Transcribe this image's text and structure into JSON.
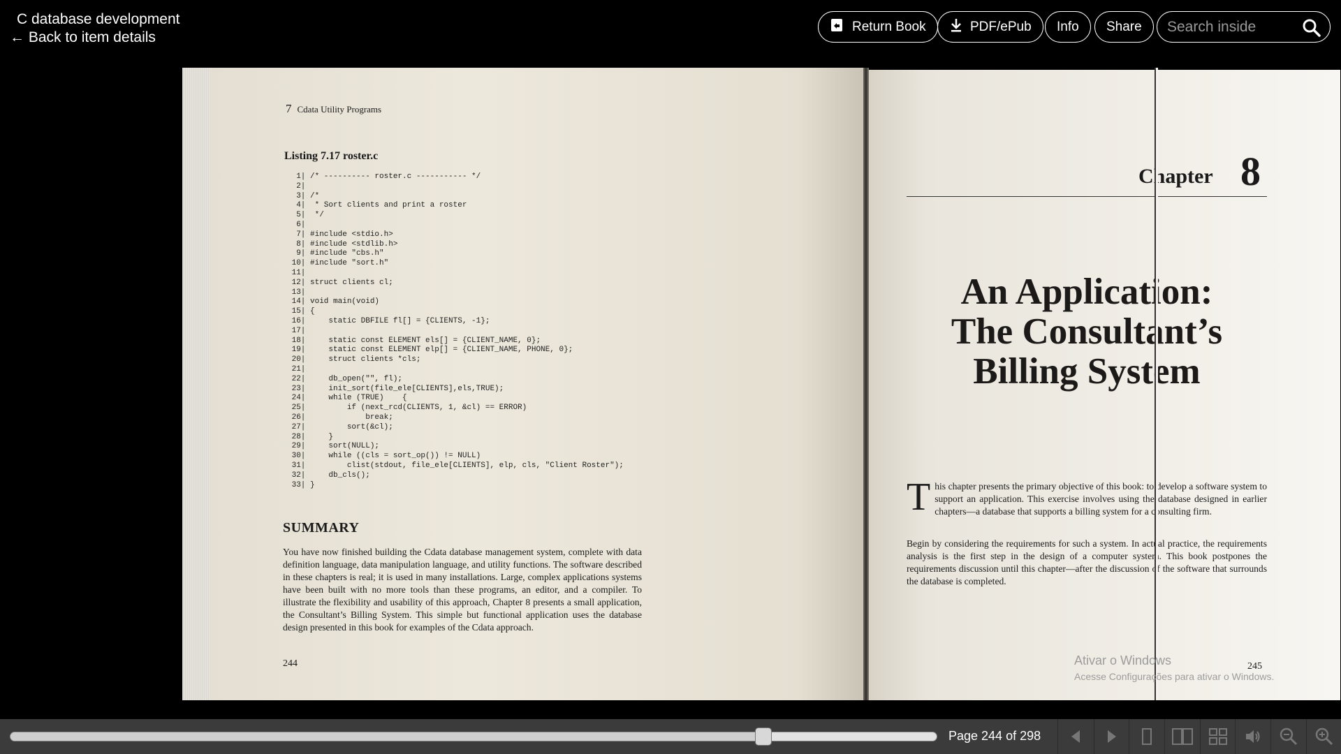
{
  "header": {
    "book_title": "C database development",
    "back_label": "← Back to item details",
    "buttons": {
      "return_book": "Return Book",
      "pdf_epub": "PDF/ePub",
      "info": "Info",
      "share": "Share"
    },
    "search_placeholder": "Search inside"
  },
  "left_page": {
    "chapter_num": "7",
    "running_head": "Cdata Utility Programs",
    "listing_title": "Listing 7.17 roster.c",
    "code": "  1| /* ---------- roster.c ----------- */\n  2|\n  3| /*\n  4|  * Sort clients and print a roster\n  5|  */\n  6|\n  7| #include <stdio.h>\n  8| #include <stdlib.h>\n  9| #include \"cbs.h\"\n 10| #include \"sort.h\"\n 11|\n 12| struct clients cl;\n 13|\n 14| void main(void)\n 15| {\n 16|     static DBFILE fl[] = {CLIENTS, -1};\n 17|\n 18|     static const ELEMENT els[] = {CLIENT_NAME, 0};\n 19|     static const ELEMENT elp[] = {CLIENT_NAME, PHONE, 0};\n 20|     struct clients *cls;\n 21|\n 22|     db_open(\"\", fl);\n 23|     init_sort(file_ele[CLIENTS],els,TRUE);\n 24|     while (TRUE)    {\n 25|         if (next_rcd(CLIENTS, 1, &cl) == ERROR)\n 26|             break;\n 27|         sort(&cl);\n 28|     }\n 29|     sort(NULL);\n 30|     while ((cls = sort_op()) != NULL)\n 31|         clist(stdout, file_ele[CLIENTS], elp, cls, \"Client Roster\");\n 32|     db_cls();\n 33| }",
    "summary_heading": "SUMMARY",
    "summary_text": "You have now finished building the Cdata database management system, complete with data definition language, data manipulation language, and utility functions. The software described in these chapters is real; it is used in many installations. Large, complex applications systems have been built with no more tools than these programs, an editor, and a compiler. To illustrate the flexibility and usability of this approach, Chapter 8 presents a small application, the Consultant’s Billing System. This simple but functional application uses the database design presented in this book for examples of the Cdata approach.",
    "folio": "244"
  },
  "right_page": {
    "chapter_label": "Chapter",
    "chapter_num": "8",
    "title_line1": "An Application:",
    "title_line2": "The Consultant’s",
    "title_line3": "Billing System",
    "dropcap": "T",
    "intro1": "his chapter presents the primary objective of this book: to develop a software system to support an application. This exercise involves using the database designed in earlier chapters—a database that supports a billing system for a consulting firm.",
    "intro2": "Begin by considering the requirements for such a system. In actual practice, the requirements analysis is the first step in the design of a computer system. This book postpones the requirements discussion until this chapter—after the discussion of the software that surrounds the database is completed.",
    "folio": "245"
  },
  "watermark": {
    "line1": "Ativar o Windows",
    "line2": "Acesse Configurações para ativar o Windows."
  },
  "footer": {
    "page_label": "Page 244 of 298",
    "current_page": 244,
    "total_pages": 298,
    "controls": [
      "previous-page-icon",
      "next-page-icon",
      "one-page-view-icon",
      "two-page-view-icon",
      "thumbnail-view-icon",
      "read-aloud-icon",
      "zoom-out-icon",
      "zoom-in-icon"
    ]
  }
}
